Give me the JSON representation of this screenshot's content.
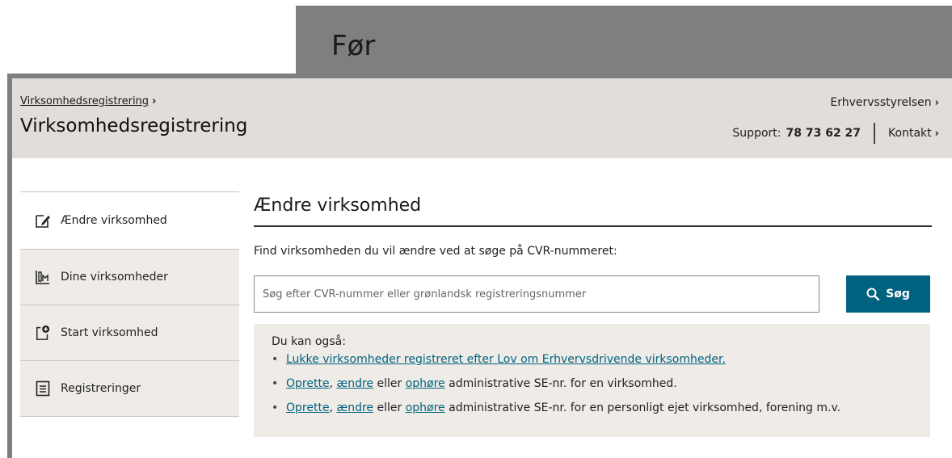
{
  "label": "Før",
  "header": {
    "breadcrumb": "Virksomhedsregistrering",
    "title": "Virksomhedsregistrering",
    "org_link": "Erhvervsstyrelsen",
    "support_label": "Support:",
    "support_number": "78 73 62 27",
    "contact_link": "Kontakt",
    "chevron": "›"
  },
  "sidebar": {
    "items": [
      {
        "label": "Ændre virksomhed",
        "icon": "edit-icon"
      },
      {
        "label": "Dine virksomheder",
        "icon": "companies-icon"
      },
      {
        "label": "Start virksomhed",
        "icon": "start-company-icon"
      },
      {
        "label": "Registreringer",
        "icon": "document-list-icon"
      }
    ]
  },
  "main": {
    "title": "Ændre virksomhed",
    "intro": "Find virksomheden du vil ændre ved at søge på CVR-nummeret:",
    "search": {
      "placeholder": "Søg efter CVR-nummer eller grønlandsk registreringsnummer",
      "button_label": "Søg"
    },
    "also": {
      "title": "Du kan også:",
      "item1_link": "Lukke virksomheder registreret efter Lov om Erhvervsdrivende virksomheder.",
      "item2": {
        "link1": "Oprette",
        "sep1": ", ",
        "link2": "ændre",
        "sep2": " eller ",
        "link3": "ophøre",
        "rest": " administrative SE-nr. for en virksomhed."
      },
      "item3": {
        "link1": "Oprette",
        "sep1": ", ",
        "link2": "ændre",
        "sep2": " eller ",
        "link3": "ophøre",
        "rest": " administrative SE-nr. for en personligt ejet virksomhed, forening m.v."
      }
    }
  },
  "colors": {
    "accent": "#00627f",
    "header_bg": "#e1ddd8",
    "sidebar_bg": "#efece8",
    "frame": "#7f7f7f"
  }
}
